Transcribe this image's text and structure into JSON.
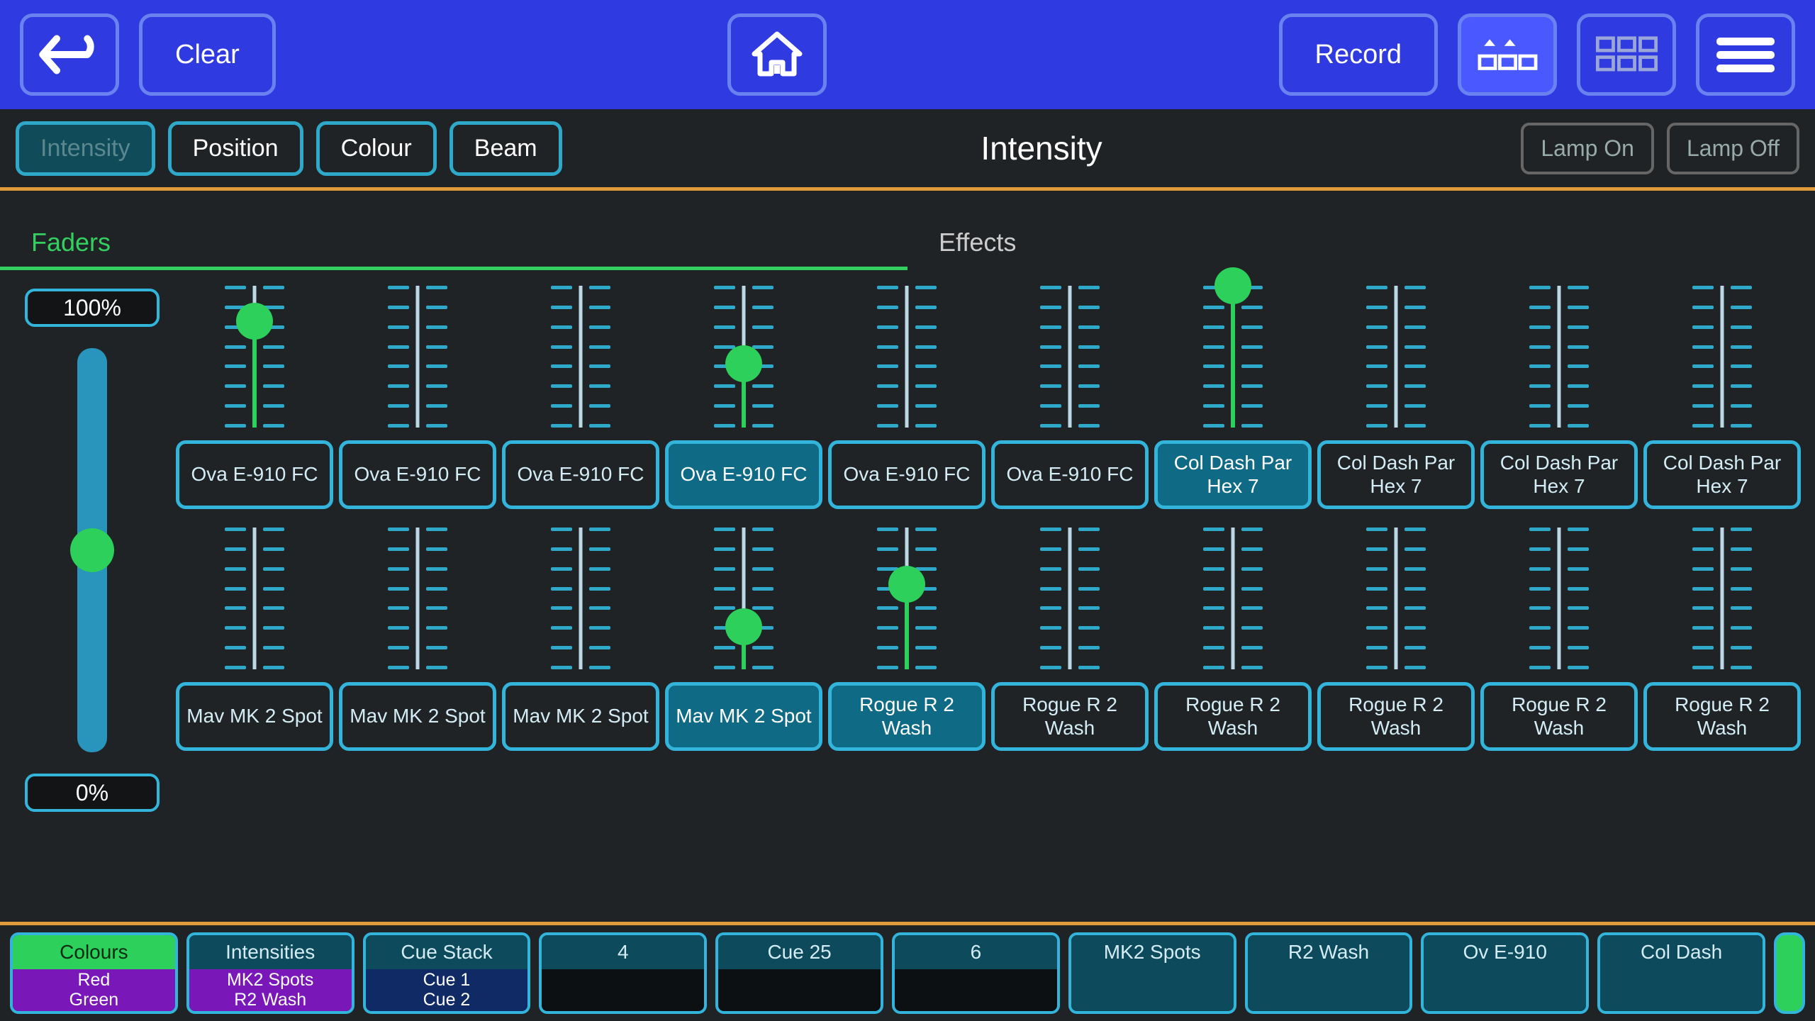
{
  "topbar": {
    "clear": "Clear",
    "record": "Record"
  },
  "attrs": {
    "intensity": "Intensity",
    "position": "Position",
    "colour": "Colour",
    "beam": "Beam",
    "title": "Intensity",
    "lamp_on": "Lamp On",
    "lamp_off": "Lamp Off"
  },
  "tabs": {
    "faders": "Faders",
    "effects": "Effects"
  },
  "master": {
    "top": "100%",
    "bottom": "0%",
    "value": 50
  },
  "rows": [
    [
      {
        "label": "Ova E-910 FC",
        "sel": false,
        "val": 75
      },
      {
        "label": "Ova E-910 FC",
        "sel": false,
        "val": null
      },
      {
        "label": "Ova E-910 FC",
        "sel": false,
        "val": null
      },
      {
        "label": "Ova E-910 FC",
        "sel": true,
        "val": 45
      },
      {
        "label": "Ova E-910 FC",
        "sel": false,
        "val": null
      },
      {
        "label": "Ova E-910 FC",
        "sel": false,
        "val": null
      },
      {
        "label": "Col Dash Par Hex 7",
        "sel": true,
        "val": 100
      },
      {
        "label": "Col Dash Par Hex 7",
        "sel": false,
        "val": null
      },
      {
        "label": "Col Dash Par Hex 7",
        "sel": false,
        "val": null
      },
      {
        "label": "Col Dash Par Hex 7",
        "sel": false,
        "val": null
      }
    ],
    [
      {
        "label": "Mav MK 2 Spot",
        "sel": false,
        "val": null
      },
      {
        "label": "Mav MK 2 Spot",
        "sel": false,
        "val": null
      },
      {
        "label": "Mav MK 2 Spot",
        "sel": false,
        "val": null
      },
      {
        "label": "Mav MK 2 Spot",
        "sel": true,
        "val": 30
      },
      {
        "label": "Rogue R 2 Wash",
        "sel": true,
        "val": 60
      },
      {
        "label": "Rogue R 2 Wash",
        "sel": false,
        "val": null
      },
      {
        "label": "Rogue R 2 Wash",
        "sel": false,
        "val": null
      },
      {
        "label": "Rogue R 2 Wash",
        "sel": false,
        "val": null
      },
      {
        "label": "Rogue R 2 Wash",
        "sel": false,
        "val": null
      },
      {
        "label": "Rogue R 2 Wash",
        "sel": false,
        "val": null
      }
    ]
  ],
  "playbacks": [
    {
      "head": "Colours",
      "head_style": "green",
      "body": [
        "Red",
        "Green"
      ],
      "body_style": "purple"
    },
    {
      "head": "Intensities",
      "body": [
        "MK2 Spots",
        "R2 Wash"
      ],
      "body_style": "purple"
    },
    {
      "head": "Cue Stack",
      "body": [
        "Cue 1",
        "Cue 2"
      ],
      "body_style": "darkblue"
    },
    {
      "head": "4",
      "body": [],
      "body_style": "black"
    },
    {
      "head": "Cue 25",
      "body": [],
      "body_style": "black"
    },
    {
      "head": "6",
      "body": [],
      "body_style": "black"
    },
    {
      "head": "MK2 Spots",
      "body": [],
      "body_style": "teal"
    },
    {
      "head": "R2 Wash",
      "body": [],
      "body_style": "teal"
    },
    {
      "head": "Ov E-910",
      "body": [],
      "body_style": "teal"
    },
    {
      "head": "Col Dash",
      "body": [],
      "body_style": "teal"
    }
  ]
}
